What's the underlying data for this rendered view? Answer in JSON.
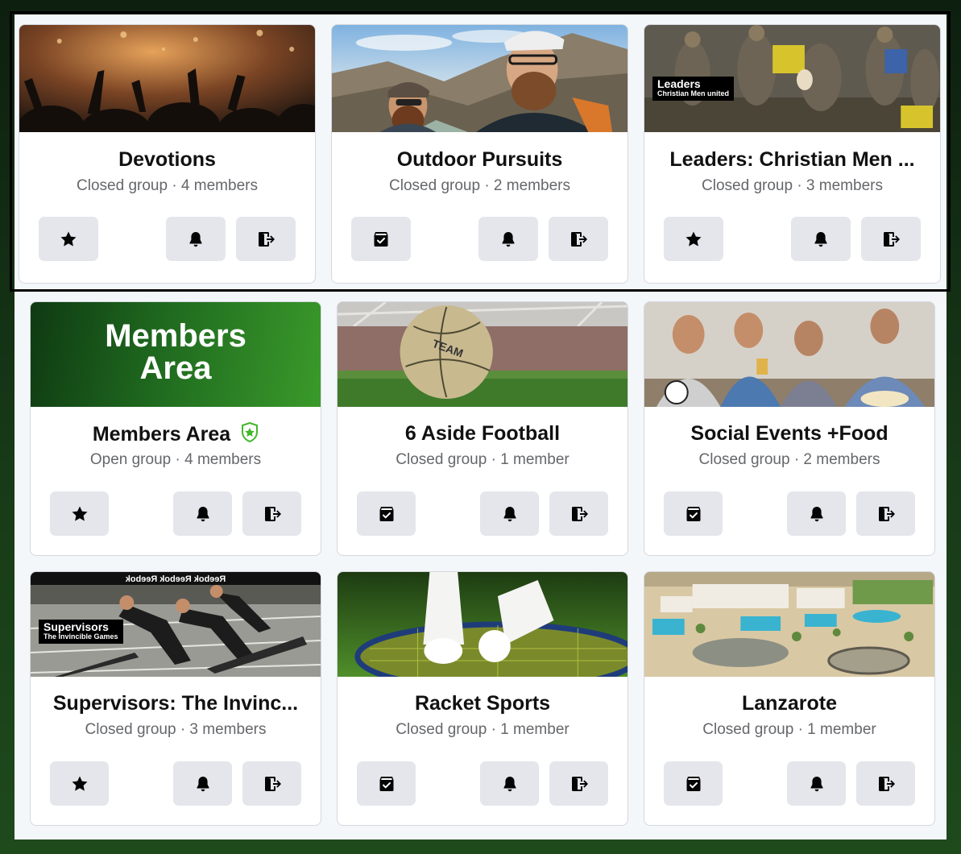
{
  "groups": [
    {
      "title": "Devotions",
      "meta": "Closed group · 4 members",
      "left_icon": "star-icon",
      "cover_label": "",
      "cover_sub": "",
      "cover_text_1": "",
      "cover_text_2": ""
    },
    {
      "title": "Outdoor Pursuits",
      "meta": "Closed group · 2 members",
      "left_icon": "archive-check-icon",
      "cover_label": "",
      "cover_sub": "",
      "cover_text_1": "",
      "cover_text_2": ""
    },
    {
      "title": "Leaders: Christian Men ...",
      "meta": "Closed group · 3 members",
      "left_icon": "star-icon",
      "cover_label": "Leaders",
      "cover_sub": "Christian Men united",
      "cover_text_1": "",
      "cover_text_2": ""
    },
    {
      "title": "Members Area",
      "meta": "Open group · 4 members",
      "left_icon": "star-icon",
      "cover_label": "",
      "cover_sub": "",
      "cover_text_1": "Members",
      "cover_text_2": "Area",
      "badge_icon": "verified-shield-icon"
    },
    {
      "title": "6 Aside Football",
      "meta": "Closed group · 1 member",
      "left_icon": "archive-check-icon",
      "cover_label": "",
      "cover_sub": "",
      "cover_text_1": "",
      "cover_text_2": "",
      "ball_text": "TEAM"
    },
    {
      "title": "Social Events +Food",
      "meta": "Closed group · 2 members",
      "left_icon": "archive-check-icon",
      "cover_label": "",
      "cover_sub": "",
      "cover_text_1": "",
      "cover_text_2": ""
    },
    {
      "title": "Supervisors: The Invinc...",
      "meta": "Closed group · 3 members",
      "left_icon": "star-icon",
      "cover_label": "Supervisors",
      "cover_sub": "The Invincible Games",
      "cover_text_1": "",
      "cover_text_2": "",
      "banner_text": "Reebok   Reebok   Reebok"
    },
    {
      "title": "Racket Sports",
      "meta": "Closed group · 1 member",
      "left_icon": "archive-check-icon",
      "cover_label": "",
      "cover_sub": "",
      "cover_text_1": "",
      "cover_text_2": ""
    },
    {
      "title": "Lanzarote",
      "meta": "Closed group · 1 member",
      "left_icon": "archive-check-icon",
      "cover_label": "",
      "cover_sub": "",
      "cover_text_1": "",
      "cover_text_2": ""
    }
  ],
  "actions": {
    "notify_icon": "bell-icon",
    "leave_icon": "leave-group-icon"
  },
  "colors": {
    "button_bg": "#e4e6eb",
    "members_green": "#2e7d22",
    "badge_green": "#42b72a"
  }
}
